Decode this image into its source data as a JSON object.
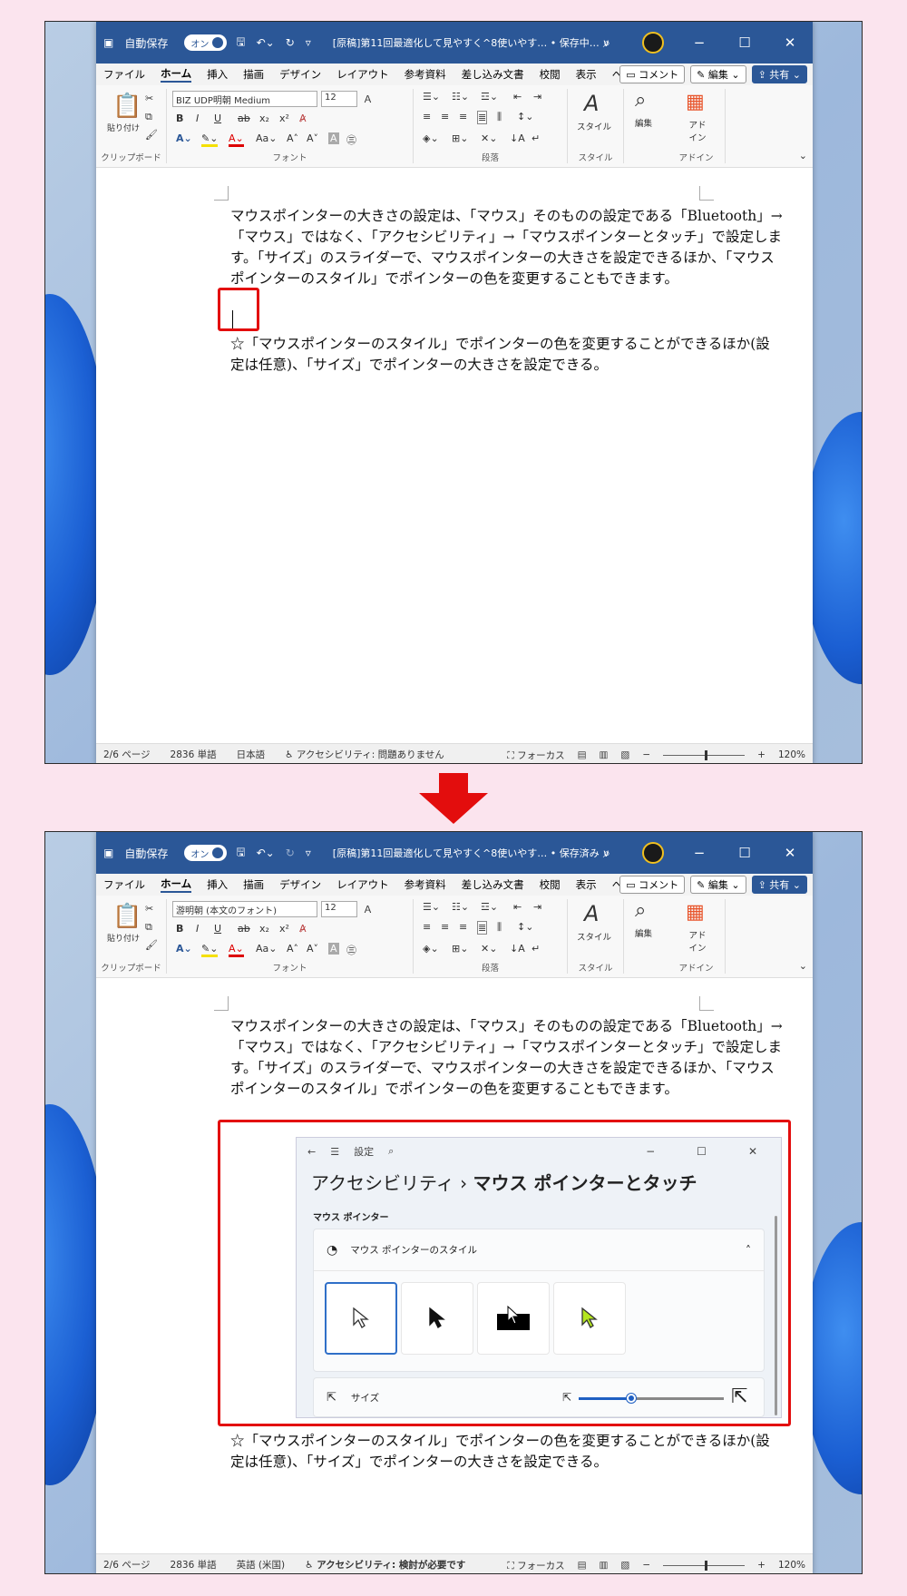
{
  "top": {
    "title_bar": {
      "autosave_label": "自動保存",
      "autosave_state": "オン",
      "doc_title": "[原稿]第11回最適化して見やすく^8使いやす… • 保存中… ∨"
    },
    "menu": [
      "ファイル",
      "ホーム",
      "挿入",
      "描画",
      "デザイン",
      "レイアウト",
      "参考資料",
      "差し込み文書",
      "校閲",
      "表示",
      "ヘルプ"
    ],
    "menu_active_index": 1,
    "comment_label": "コメント",
    "edit_label": "編集",
    "share_label": "共有",
    "ribbon": {
      "paste_label": "貼り付け",
      "font_name": "BIZ UDP明朝 Medium",
      "font_size": "12",
      "groups": [
        "クリップボード",
        "フォント",
        "段落",
        "スタイル",
        "アドイン"
      ],
      "style_label": "スタイル",
      "edit_label": "編集",
      "addin_label": "アド イン"
    },
    "paragraphs": [
      "マウスポインターの大きさの設定は、「マウス」そのものの設定である「Bluetooth」→「マウス」ではなく、「アクセシビリティ」→「マウスポインターとタッチ」で設定します。「サイズ」のスライダーで、マウスポインターの大きさを設定できるほか、「マウスポインターのスタイル」でポインターの色を変更することもできます。",
      "☆「マウスポインターのスタイル」でポインターの色を変更することができるほか(設定は任意)、「サイズ」でポインターの大きさを設定できる。"
    ],
    "status": {
      "page": "2/6 ページ",
      "words": "2836 単語",
      "language": "日本語",
      "accessibility": "アクセシビリティ: 問題ありません",
      "focus": "フォーカス",
      "zoom": "120%"
    }
  },
  "bottom": {
    "title_bar": {
      "autosave_label": "自動保存",
      "autosave_state": "オン",
      "doc_title": "[原稿]第11回最適化して見やすく^8使いやす… • 保存済み ∨"
    },
    "menu": [
      "ファイル",
      "ホーム",
      "挿入",
      "描画",
      "デザイン",
      "レイアウト",
      "参考資料",
      "差し込み文書",
      "校閲",
      "表示",
      "ヘルプ"
    ],
    "menu_active_index": 1,
    "comment_label": "コメント",
    "edit_label": "編集",
    "share_label": "共有",
    "ribbon": {
      "paste_label": "貼り付け",
      "font_name": "游明朝 (本文のフォント)",
      "font_size": "12",
      "groups": [
        "クリップボード",
        "フォント",
        "段落",
        "スタイル",
        "アドイン"
      ],
      "style_label": "スタイル",
      "edit_label": "編集",
      "addin_label": "アド イン"
    },
    "paragraphs": [
      "マウスポインターの大きさの設定は、「マウス」そのものの設定である「Bluetooth」→「マウス」ではなく、「アクセシビリティ」→「マウスポインターとタッチ」で設定します。「サイズ」のスライダーで、マウスポインターの大きさを設定できるほか、「マウスポインターのスタイル」でポインターの色を変更することもできます。",
      "☆「マウスポインターのスタイル」でポインターの色を変更することができるほか(設定は任意)、「サイズ」でポインターの大きさを設定できる。"
    ],
    "settings": {
      "app_label": "設定",
      "breadcrumb_parent": "アクセシビリティ",
      "breadcrumb_sep": "›",
      "breadcrumb_current": "マウス ポインターとタッチ",
      "section_label": "マウス ポインター",
      "style_label": "マウス ポインターのスタイル",
      "size_label": "サイズ",
      "slider_fraction": 0.36
    },
    "status": {
      "page": "2/6 ページ",
      "words": "2836 単語",
      "language": "英語 (米国)",
      "accessibility": "アクセシビリティ: 検討が必要です",
      "focus": "フォーカス",
      "zoom": "120%"
    }
  },
  "colors": {
    "title_bar": "#2b5797",
    "highlight": "#e30d0d",
    "accent": "#1f5fc2",
    "background": "#fbe4ee"
  }
}
